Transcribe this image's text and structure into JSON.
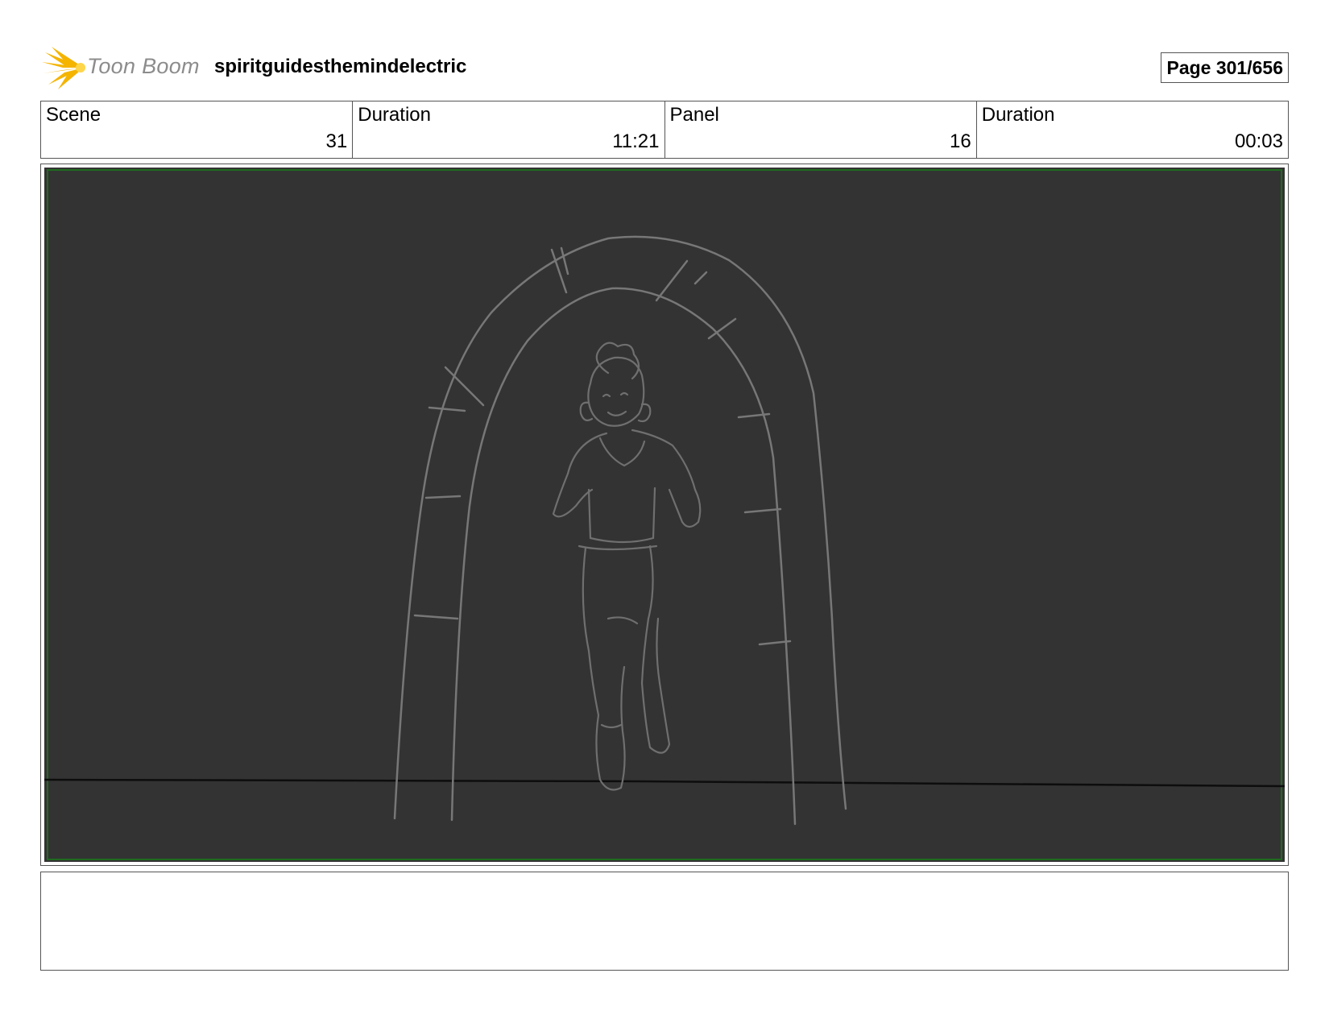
{
  "header": {
    "logo_text": "Toon Boom",
    "project_title": "spiritguidesthemindelectric",
    "page_label": "Page 301/656"
  },
  "info": {
    "scene_label": "Scene",
    "scene_value": "31",
    "scene_duration_label": "Duration",
    "scene_duration_value": "11:21",
    "panel_label": "Panel",
    "panel_value": "16",
    "panel_duration_label": "Duration",
    "panel_duration_value": "00:03"
  },
  "panel": {
    "background": "#333333",
    "sketch_color": "#777777",
    "safe_frame_color": "#1f6b1f"
  },
  "notes": {
    "text": ""
  }
}
